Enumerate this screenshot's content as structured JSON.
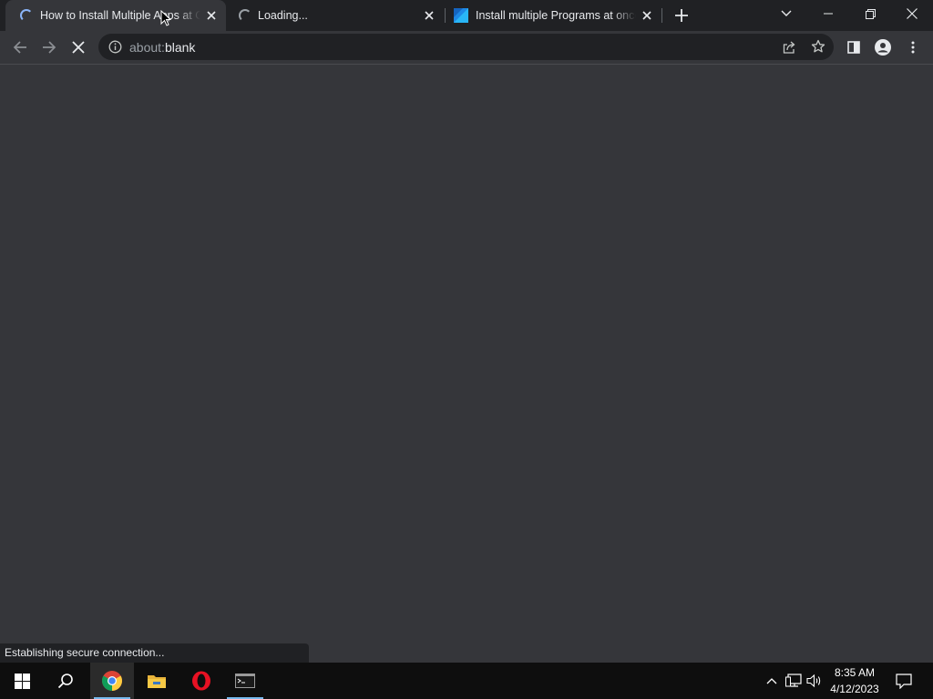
{
  "tabs": [
    {
      "title": "How to Install Multiple Apps at Once",
      "state": "loading",
      "active": true
    },
    {
      "title": "Loading...",
      "state": "loading",
      "active": false
    },
    {
      "title": "Install multiple Programs at once",
      "state": "loaded",
      "active": false
    }
  ],
  "omnibox": {
    "prefix": "about:",
    "host": "blank"
  },
  "status_text": "Establishing secure connection...",
  "clock": {
    "time": "8:35 AM",
    "date": "4/12/2023"
  },
  "colors": {
    "accent": "#8ab4f8",
    "frame": "#202124",
    "toolbar": "#35363a",
    "taskbar": "#0e0e0e"
  }
}
